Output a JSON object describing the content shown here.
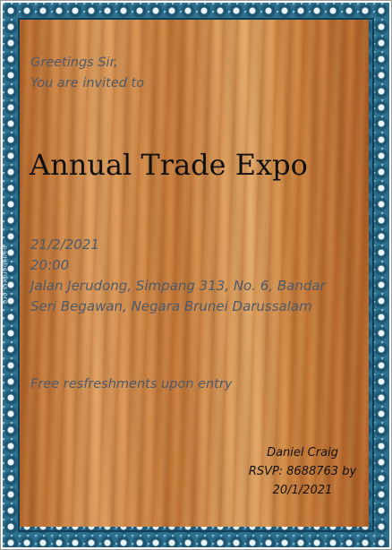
{
  "invitation": {
    "greeting_line1": "Greetings Sir,",
    "greeting_line2": "You are invited to",
    "title": "Annual Trade Expo",
    "date": "21/2/2021",
    "time": "20:00",
    "address": "Jalan Jerudong, Simpang 313, No. 6, Bandar Seri Begawan, Negara Brunei Darussalam",
    "note": "Free resfreshments upon entry",
    "host_name": "Daniel Craig",
    "rsvp_line1": "RSVP: 8688763 by",
    "rsvp_line2": "20/1/2021"
  },
  "border": {
    "credit": "pageborders.org",
    "frame_color": "#2d6f8e"
  }
}
